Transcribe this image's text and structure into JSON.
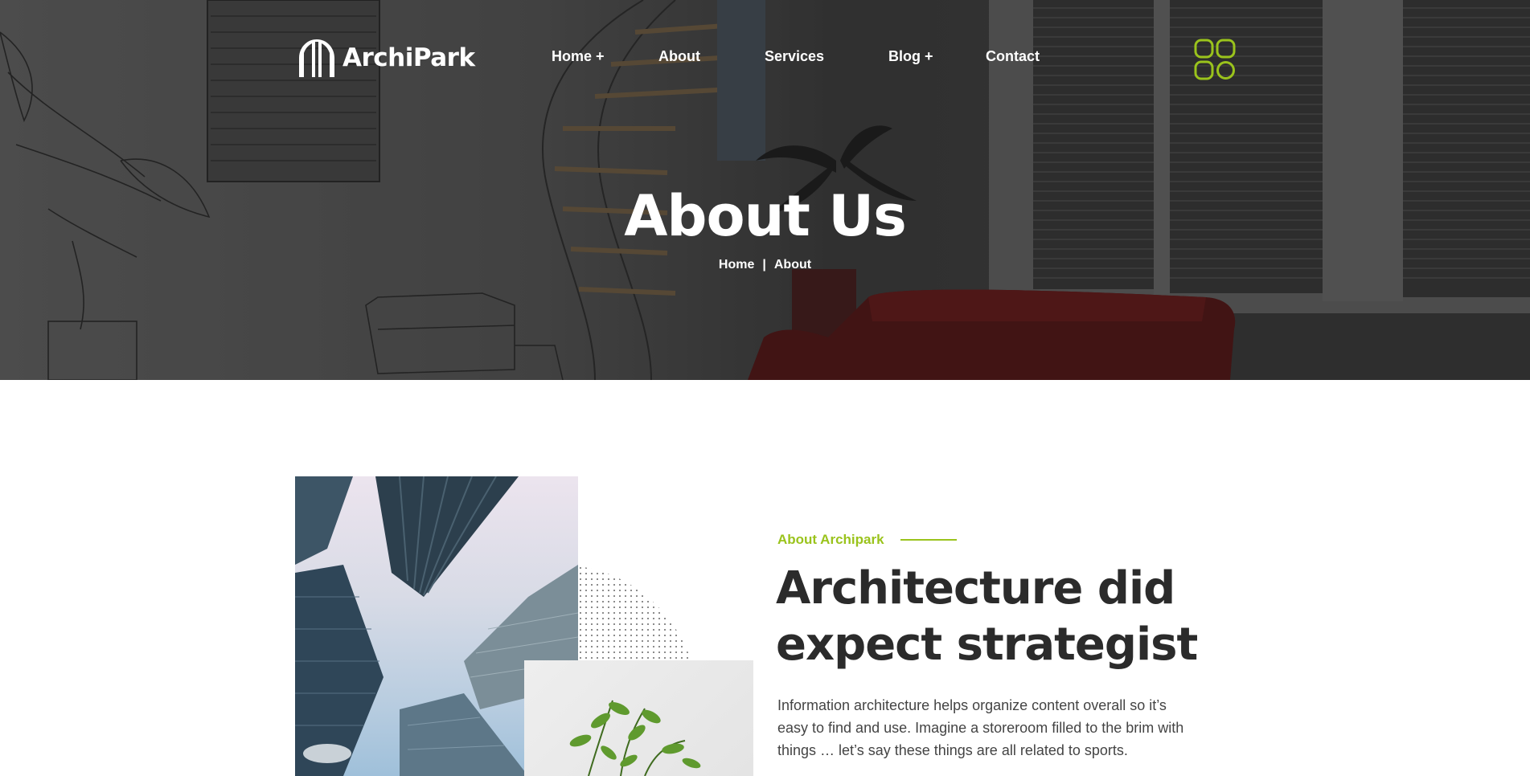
{
  "brand": {
    "name": "ArchiPark",
    "accent_color": "#9ac31c",
    "logo_icon": "building-logo-icon"
  },
  "nav": {
    "items": [
      {
        "label": "Home +"
      },
      {
        "label": "About"
      },
      {
        "label": "Services"
      },
      {
        "label": "Blog +"
      },
      {
        "label": "Contact"
      }
    ],
    "menu_icon": "grid-menu-icon"
  },
  "hero": {
    "title": "About Us",
    "breadcrumb": {
      "home": "Home",
      "separator": "|",
      "current": "About"
    }
  },
  "about": {
    "eyebrow": "About Archipark",
    "title_line1": "Architecture did",
    "title_line2": "expect strategist",
    "body": "Information architecture helps organize content overall so it’s easy to find and use. Imagine a storeroom filled to the brim with things … let’s say these things are all related to sports."
  }
}
